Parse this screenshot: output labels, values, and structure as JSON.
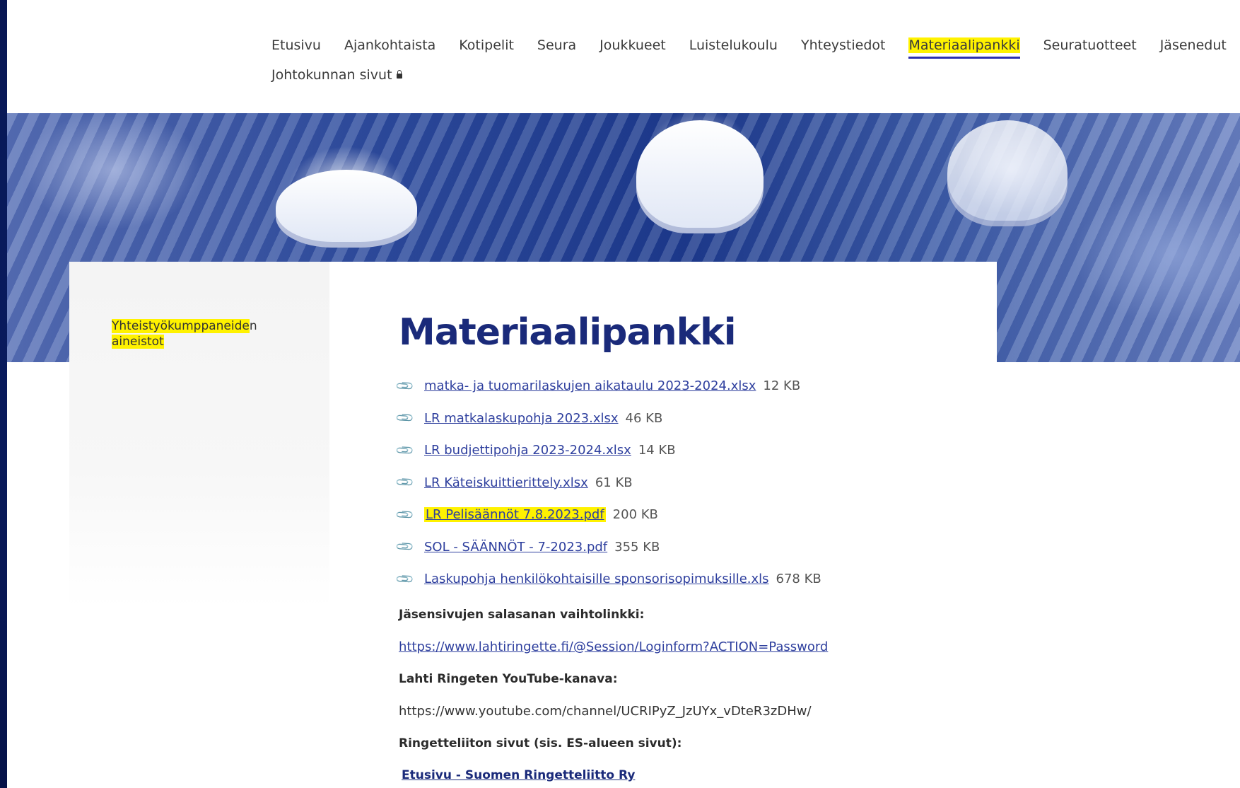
{
  "nav": {
    "items": [
      {
        "label": "Etusivu"
      },
      {
        "label": "Ajankohtaista"
      },
      {
        "label": "Kotipelit"
      },
      {
        "label": "Seura"
      },
      {
        "label": "Joukkueet"
      },
      {
        "label": "Luistelukoulu"
      },
      {
        "label": "Yhteystiedot"
      },
      {
        "label": "Materiaalipankki"
      },
      {
        "label": "Seuratuotteet"
      },
      {
        "label": "Jäsenedut"
      },
      {
        "label": "Johtokunnan sivut"
      }
    ],
    "active": "Materiaalipankki"
  },
  "sidebar": {
    "link_part1": "Yhteistyökumppaneide",
    "link_part2": "n",
    "link_part3": "aineistot"
  },
  "main": {
    "title": "Materiaalipankki",
    "files": [
      {
        "name": "matka- ja tuomarilaskujen aikataulu 2023-2024.xlsx",
        "size": "12 KB"
      },
      {
        "name": "LR matkalaskupohja 2023.xlsx",
        "size": "46 KB"
      },
      {
        "name": "LR  budjettipohja 2023-2024.xlsx",
        "size": "14 KB"
      },
      {
        "name": "LR  Käteiskuittierittely.xlsx",
        "size": "61 KB"
      },
      {
        "name": "LR Pelisäännöt 7.8.2023.pdf",
        "size": "200 KB"
      },
      {
        "name": "SOL - SÄÄNNÖT - 7-2023.pdf",
        "size": "355 KB"
      },
      {
        "name": "Laskupohja henkilökohtaisille sponsorisopimuksille.xls",
        "size": "678 KB"
      }
    ],
    "password_heading": "Jäsensivujen salasanan vaihtolinkki:",
    "password_link": "https://www.lahtiringette.fi/@Session/Loginform?ACTION=Password",
    "youtube_heading": "Lahti Ringeten YouTube-kanava:",
    "youtube_url": "https://www.youtube.com/channel/UCRIPyZ_JzUYx_vDteR3zDHw/",
    "ringette_heading": "Ringetteliiton sivut (sis. ES-alueen sivut):",
    "ringette_link": "Etusivu - Suomen Ringetteliitto Ry"
  },
  "colors": {
    "highlight": "#fff200",
    "link": "#2e3f9e",
    "title": "#1a2a7a",
    "frame": "#0a1f66"
  },
  "icons": {
    "attachment": "paperclip-icon",
    "lock": "lock-icon"
  }
}
